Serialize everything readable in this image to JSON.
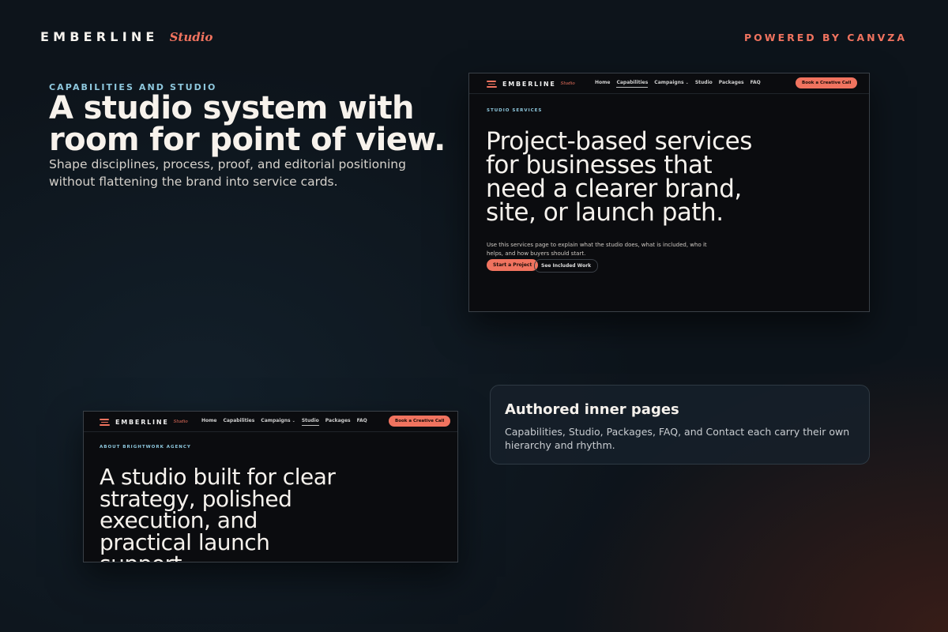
{
  "header": {
    "brand_name": "EMBERLINE",
    "brand_sub": "Studio",
    "powered": "POWERED BY CANVZA"
  },
  "hero": {
    "eyebrow": "CAPABILITIES AND STUDIO",
    "headline": "A studio system with room for point of view.",
    "lead": "Shape disciplines, process, proof, and editorial positioning without flattening the brand into service cards."
  },
  "mock_services": {
    "brand_name": "EMBERLINE",
    "brand_sub": "Studio",
    "nav": [
      "Home",
      "Capabilities",
      "Campaigns",
      "Studio",
      "Packages",
      "FAQ"
    ],
    "active_nav": "Capabilities",
    "cta": "Book a Creative Call",
    "eyebrow": "STUDIO SERVICES",
    "headline": "Project-based services for businesses that need a clearer brand, site, or launch path.",
    "body": "Use this services page to explain what the studio does, what is included, who it helps, and how buyers should start.",
    "primary_button": "Start a Project",
    "secondary_button": "See Included Work"
  },
  "mock_about": {
    "brand_name": "EMBERLINE",
    "brand_sub": "Studio",
    "nav": [
      "Home",
      "Capabilities",
      "Campaigns",
      "Studio",
      "Packages",
      "FAQ"
    ],
    "active_nav": "Studio",
    "cta": "Book a Creative Call",
    "eyebrow": "ABOUT BRIGHTWORK AGENCY",
    "headline": "A studio built for clear strategy, polished execution, and practical launch support."
  },
  "card": {
    "title": "Authored inner pages",
    "body": "Capabilities, Studio, Packages, FAQ, and Contact each carry their own hierarchy and rhythm."
  },
  "colors": {
    "accent": "#f0735f",
    "eyebrow": "#8ec8de",
    "background": "#0d141b"
  }
}
